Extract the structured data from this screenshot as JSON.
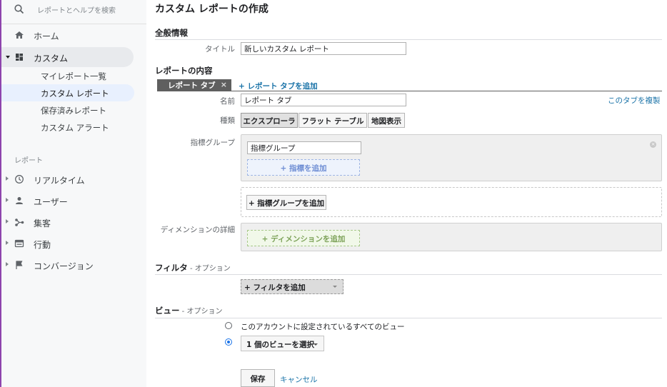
{
  "sidebar": {
    "search_placeholder": "レポートとヘルプを検索",
    "home": "ホーム",
    "custom": "カスタム",
    "custom_items": [
      "マイレポート一覧",
      "カスタム レポート",
      "保存済みレポート",
      "カスタム アラート"
    ],
    "section_label": "レポート",
    "reports": [
      "リアルタイム",
      "ユーザー",
      "集客",
      "行動",
      "コンバージョン"
    ]
  },
  "main": {
    "page_title": "カスタム レポートの作成",
    "general_heading": "全般情報",
    "title_label": "タイトル",
    "title_value": "新しいカスタム レポート",
    "content_heading": "レポートの内容",
    "tab_label": "レポート タブ",
    "tab_close": "×",
    "add_tab": "+ レポート タブを追加",
    "name_label": "名前",
    "name_value": "レポート タブ",
    "duplicate_tab": "このタブを複製",
    "type_label": "種類",
    "type_options": [
      "エクスプローラ",
      "フラット テーブル",
      "地図表示"
    ],
    "metric_group_label": "指標グループ",
    "metric_group_name": "指標グループ",
    "add_metric": "+ 指標を追加",
    "add_metric_group": "+ 指標グループを追加",
    "dimension_label": "ディメンションの詳細",
    "add_dimension": "+ ディメンションを追加",
    "filter_heading": "フィルタ",
    "filter_optional": " - オプション",
    "add_filter": "+ フィルタを追加",
    "view_heading": "ビュー",
    "view_optional": " - オプション",
    "view_all": "このアカウントに設定されているすべてのビュー",
    "view_select": "1 個のビューを選択",
    "save": "保存",
    "cancel": "キャンセル"
  },
  "colors": {
    "sidebar_bg": "#f7f8f9",
    "link": "#1a73a8",
    "tab_dark": "#5f5f5f",
    "radio_selected": "#1a73e8",
    "sidebar_accent_line": "#8e44ad"
  }
}
